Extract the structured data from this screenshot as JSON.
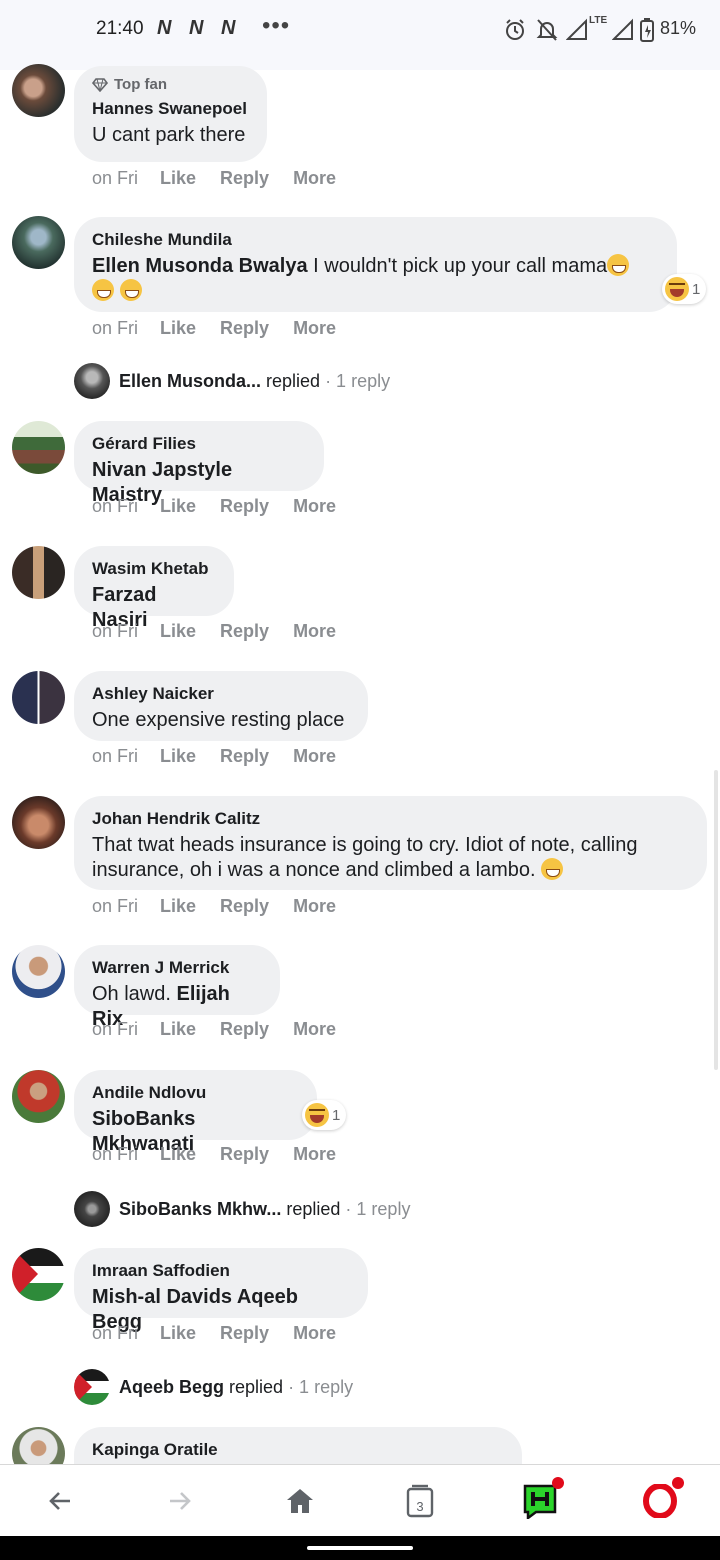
{
  "status_bar": {
    "time": "21:40",
    "notification_icons": [
      "N",
      "N",
      "N"
    ],
    "more": "•••",
    "network": "LTE",
    "battery": "81%"
  },
  "comments": [
    {
      "badge": "Top fan",
      "author": "Hannes Swanepoel",
      "body_parts": [
        {
          "t": "U cant park there",
          "bold": false
        }
      ],
      "time": "on Fri",
      "like": "Like",
      "reply": "Reply",
      "more": "More"
    },
    {
      "author": "Chileshe Mundila",
      "body_parts": [
        {
          "t": "Ellen Musonda Bwalya",
          "bold": true
        },
        {
          "t": " I wouldn't pick up your call mama",
          "bold": false
        }
      ],
      "time": "on Fri",
      "like": "Like",
      "reply": "Reply",
      "more": "More",
      "reaction_count": "1"
    },
    {
      "author": "Gérard Filies",
      "body_parts": [
        {
          "t": "Nivan Japstyle Maistry",
          "bold": true
        }
      ],
      "time": "on Fri",
      "like": "Like",
      "reply": "Reply",
      "more": "More"
    },
    {
      "author": "Wasim Khetab",
      "body_parts": [
        {
          "t": "Farzad Nasiri",
          "bold": true
        }
      ],
      "time": "on Fri",
      "like": "Like",
      "reply": "Reply",
      "more": "More"
    },
    {
      "author": "Ashley Naicker",
      "body_parts": [
        {
          "t": "One expensive resting place",
          "bold": false
        }
      ],
      "time": "on Fri",
      "like": "Like",
      "reply": "Reply",
      "more": "More"
    },
    {
      "author": "Johan Hendrik Calitz",
      "body_line1": "That twat heads insurance is going to cry. Idiot of note, calling",
      "body_line2": "insurance, oh i was a nonce and climbed a lambo.",
      "time": "on Fri",
      "like": "Like",
      "reply": "Reply",
      "more": "More"
    },
    {
      "author": "Warren J Merrick",
      "body_parts": [
        {
          "t": "Oh lawd. ",
          "bold": false
        },
        {
          "t": "Elijah Rix",
          "bold": true
        }
      ],
      "time": "on Fri",
      "like": "Like",
      "reply": "Reply",
      "more": "More"
    },
    {
      "author": "Andile Ndlovu",
      "body_parts": [
        {
          "t": "SiboBanks Mkhwanati",
          "bold": true
        }
      ],
      "time": "on Fri",
      "like": "Like",
      "reply": "Reply",
      "more": "More",
      "reaction_count": "1"
    },
    {
      "author": "Imraan Saffodien",
      "body_parts": [
        {
          "t": "Mish-al Davids Aqeeb Begg",
          "bold": true
        }
      ],
      "time": "on Fri",
      "like": "Like",
      "reply": "Reply",
      "more": "More"
    },
    {
      "author": "Kapinga Oratile"
    }
  ],
  "replies": [
    {
      "name": "Ellen Musonda...",
      "verb": "replied",
      "count": "· 1 reply"
    },
    {
      "name": "SiboBanks Mkhw...",
      "verb": "replied",
      "count": "· 1 reply"
    },
    {
      "name": "Aqeeb Begg",
      "verb": "replied",
      "count": "· 1 reply"
    }
  ],
  "bottom_nav": {
    "tab_count": "3"
  },
  "colors": {
    "bubble": "#eff0f2",
    "meta_text": "#8a8d91",
    "opera_red": "#e10a1a",
    "hype_green": "#2bd52b"
  }
}
